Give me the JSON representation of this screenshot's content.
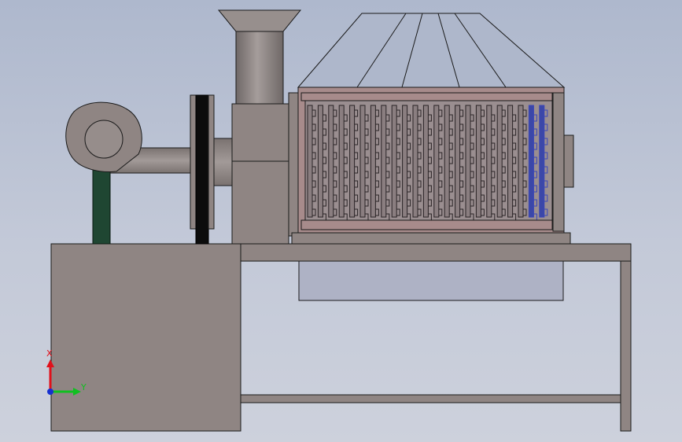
{
  "viewport": {
    "background": "#c0c7d6"
  },
  "triad": {
    "x_label": "X",
    "y_label": "Y",
    "x_color": "#e0101a",
    "y_color": "#10c020",
    "origin_color": "#1530d0"
  },
  "model": {
    "body_color": "#8f8583",
    "edge_color": "#1a1a1a",
    "pulley_color": "#0c0c0c",
    "support_color": "#1f4632",
    "drum_color": "#a78b8b",
    "screen_color": "#9a8e90",
    "screen_highlight_color": "#3a46b8",
    "hood_color": "#aeb7cb"
  }
}
